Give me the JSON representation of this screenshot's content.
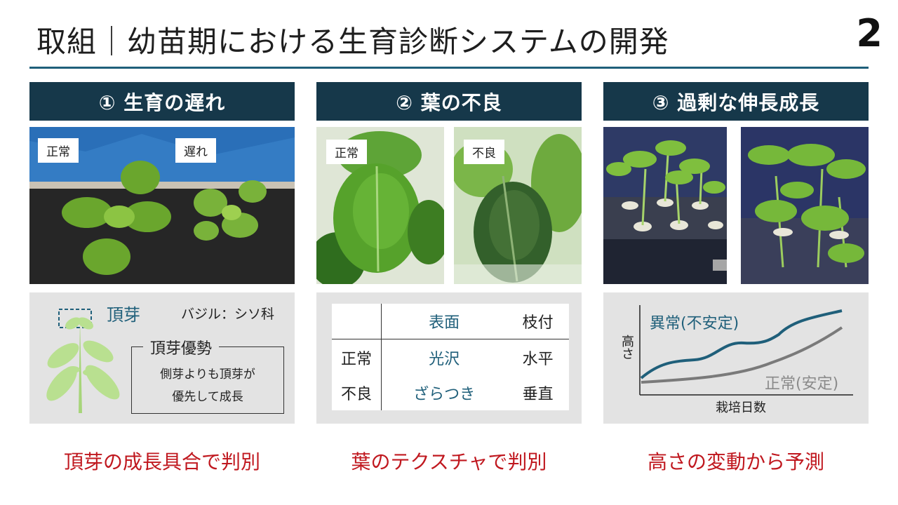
{
  "slide": {
    "title": "取組｜幼苗期における生育診断システムの開発",
    "page_number": "2"
  },
  "columns": [
    {
      "header": "① 生育の遅れ",
      "tags": [
        "正常",
        "遅れ"
      ],
      "plant_label": "頂芽",
      "species_label": "バジル：シソ科",
      "box_title": "頂芽優勢",
      "box_lines": [
        "側芽よりも頂芽が",
        "優先して成長"
      ],
      "result": "頂芽の成長具合で判別"
    },
    {
      "header": "② 葉の不良",
      "tags": [
        "正常",
        "不良"
      ],
      "table": {
        "col_headers": [
          "表面",
          "枝付"
        ],
        "rows": [
          {
            "label": "正常",
            "values": [
              "光沢",
              "水平"
            ]
          },
          {
            "label": "不良",
            "values": [
              "ざらつき",
              "垂直"
            ]
          }
        ]
      },
      "result": "葉のテクスチャで判別"
    },
    {
      "header": "③ 過剰な伸長成長",
      "graph": {
        "series_abnormal": "異常(不安定)",
        "series_normal": "正常(安定)",
        "ylabel": "高さ",
        "xlabel": "栽培日数"
      },
      "result": "高さの変動から予測"
    }
  ],
  "colors": {
    "header_bg": "#16384a",
    "accent": "#1f5f7a",
    "result_red": "#c0181f",
    "panel_bg": "#e3e3e3"
  }
}
